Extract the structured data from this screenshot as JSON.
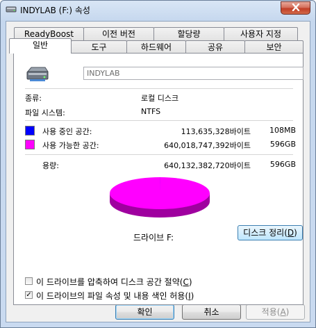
{
  "window": {
    "title": "INDYLAB (F:) 속성"
  },
  "tabs_row1": [
    {
      "label": "ReadyBoost"
    },
    {
      "label": "이전 버전"
    },
    {
      "label": "할당량"
    },
    {
      "label": "사용자 지정"
    }
  ],
  "tabs_row2": [
    {
      "label": "일반"
    },
    {
      "label": "도구"
    },
    {
      "label": "하드웨어"
    },
    {
      "label": "공유"
    },
    {
      "label": "보안"
    }
  ],
  "general": {
    "volume_name": "INDYLAB",
    "type_label": "종류:",
    "type_value": "로컬 디스크",
    "fs_label": "파일 시스템:",
    "fs_value": "NTFS",
    "used_label": "사용 중인 공간:",
    "used_bytes": "113,635,328바이트",
    "used_short": "108MB",
    "free_label": "사용 가능한 공간:",
    "free_bytes": "640,018,747,392바이트",
    "free_short": "596GB",
    "capacity_label": "용량:",
    "capacity_bytes": "640,132,382,720바이트",
    "capacity_short": "596GB",
    "drive_label": "드라이브 F:",
    "cleanup_label": "디스크 정리",
    "cleanup_key": "D",
    "compress_label": "이 드라이브를 압축하여 디스크 공간 절약",
    "compress_key": "C",
    "index_label": "이 드라이브의 파일 속성 및 내용 색인 허용",
    "index_key": "I",
    "compress_checked": false,
    "index_checked": true
  },
  "buttons": {
    "ok": "확인",
    "cancel": "취소",
    "apply": "적용",
    "apply_key": "A"
  },
  "colors": {
    "used": "#0000ff",
    "free": "#ff00ff"
  },
  "chart_data": {
    "type": "pie",
    "categories": [
      "사용 중인 공간",
      "사용 가능한 공간"
    ],
    "values": [
      113635328,
      640018747392
    ],
    "title": ""
  }
}
